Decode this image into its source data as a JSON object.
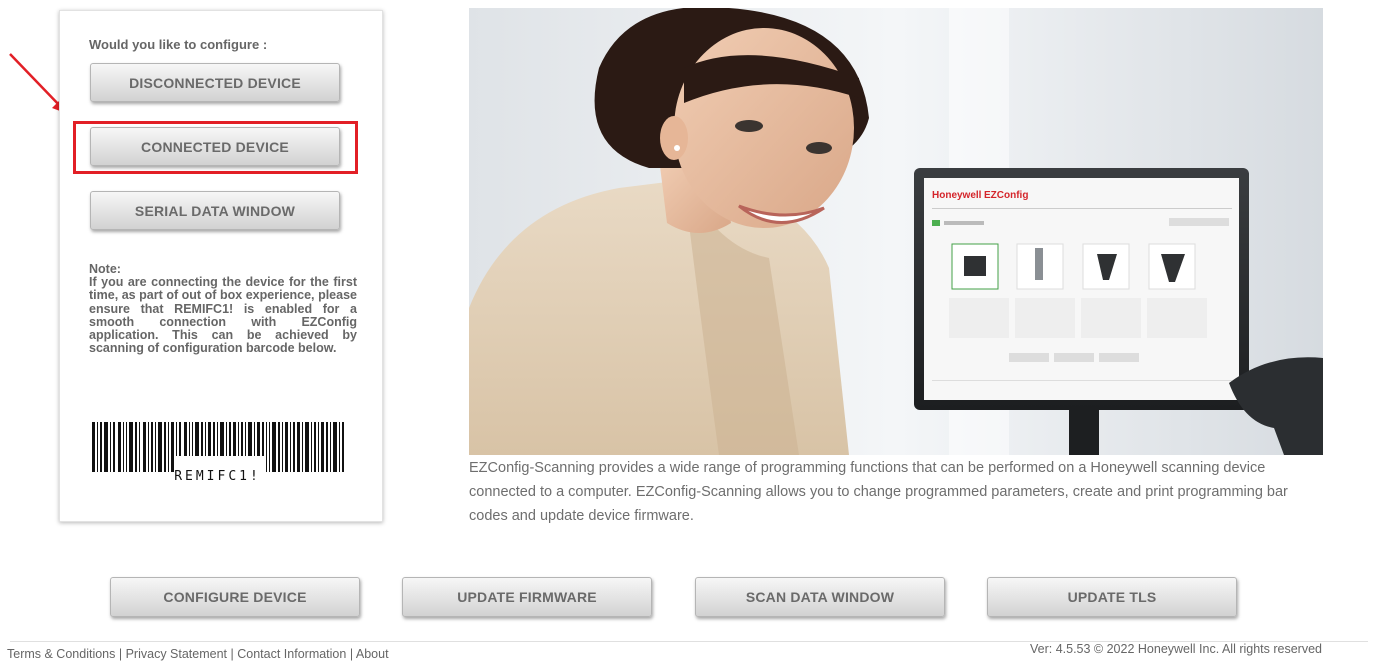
{
  "configure_panel": {
    "question": "Would you like to configure :",
    "buttons": {
      "disconnected": "DISCONNECTED DEVICE",
      "connected": "CONNECTED DEVICE",
      "serial": "SERIAL DATA WINDOW"
    },
    "note_title": "Note:",
    "note_body": "If you are connecting the device for the first time, as part of out of box experience, please ensure that REMIFC1! is enabled for a smooth connection with EZConfig application. This can be achieved by scanning of configuration barcode below.",
    "barcode_text": "REMIFC1!"
  },
  "hero": {
    "monitor_brand": "Honeywell",
    "monitor_app": "EZConfig"
  },
  "description": "EZConfig-Scanning provides a wide range of programming functions that can be performed on a Honeywell scanning device connected to a computer. EZConfig-Scanning allows you to change programmed parameters, create and print programming bar codes and update device firmware.",
  "actions": {
    "configure_device": "CONFIGURE DEVICE",
    "update_firmware": "UPDATE FIRMWARE",
    "scan_data_window": "SCAN DATA WINDOW",
    "update_tls": "UPDATE TLS"
  },
  "footer": {
    "links": {
      "terms": "Terms & Conditions",
      "privacy": "Privacy Statement",
      "contact": "Contact Information",
      "about": "About"
    },
    "separator": "|",
    "version": "Ver: 4.5.53 © 2022 Honeywell Inc. All rights reserved"
  },
  "colors": {
    "highlight": "#e21f26",
    "arrow": "#e21f26",
    "honeywell_red": "#d4242a",
    "text_gray": "#666666"
  },
  "annotations": {
    "arrow_icon": "red-arrow-icon",
    "highlight_box": "red-highlight-rectangle"
  }
}
